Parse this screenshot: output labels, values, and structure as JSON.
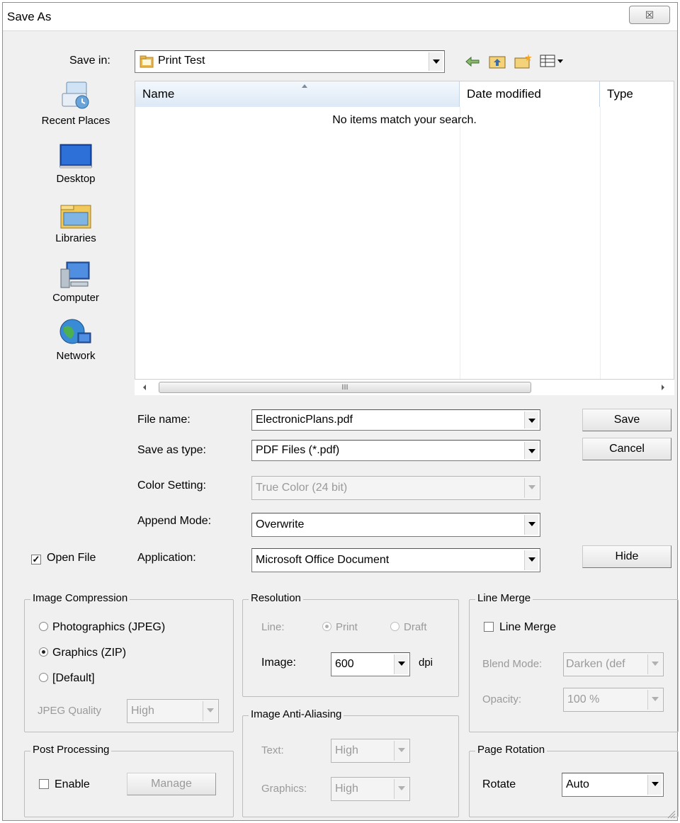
{
  "window": {
    "title": "Save As",
    "close_glyph": "☒"
  },
  "save_in": {
    "label": "Save in:",
    "value": "Print Test",
    "icons": [
      "back-arrow-icon",
      "up-folder-icon",
      "new-folder-icon",
      "view-menu-icon"
    ]
  },
  "places": [
    {
      "label": "Recent Places",
      "icon": "recent-places-icon"
    },
    {
      "label": "Desktop",
      "icon": "desktop-icon"
    },
    {
      "label": "Libraries",
      "icon": "libraries-icon"
    },
    {
      "label": "Computer",
      "icon": "computer-icon"
    },
    {
      "label": "Network",
      "icon": "network-icon"
    }
  ],
  "file_list": {
    "columns": [
      "Name",
      "Date modified",
      "Type"
    ],
    "empty_message": "No items match your search.",
    "scroll_grip": "III"
  },
  "form": {
    "file_name": {
      "label": "File name:",
      "value": "ElectronicPlans.pdf"
    },
    "save_as_type": {
      "label": "Save as type:",
      "value": "PDF Files (*.pdf)"
    },
    "color_setting": {
      "label": "Color Setting:",
      "value": "True Color (24 bit)"
    },
    "append_mode": {
      "label": "Append Mode:",
      "value": "Overwrite"
    },
    "application": {
      "label": "Application:",
      "value": "Microsoft Office Document"
    },
    "open_file": {
      "label": "Open File",
      "checked": true
    }
  },
  "buttons": {
    "save": "Save",
    "cancel": "Cancel",
    "hide": "Hide",
    "manage": "Manage"
  },
  "image_compression": {
    "title": "Image Compression",
    "options": [
      {
        "label": "Photographics (JPEG)",
        "selected": false
      },
      {
        "label": "Graphics (ZIP)",
        "selected": true
      },
      {
        "label": "[Default]",
        "selected": false
      }
    ],
    "jpeg_quality_label": "JPEG Quality",
    "jpeg_quality_value": "High"
  },
  "resolution": {
    "title": "Resolution",
    "line_label": "Line:",
    "line_print": "Print",
    "line_draft": "Draft",
    "image_label": "Image:",
    "image_value": "600",
    "unit": "dpi"
  },
  "line_merge": {
    "title": "Line Merge",
    "checkbox_label": "Line Merge",
    "blend_mode_label": "Blend Mode:",
    "blend_mode_value": "Darken (def",
    "opacity_label": "Opacity:",
    "opacity_value": "100 %"
  },
  "anti_aliasing": {
    "title": "Image Anti-Aliasing",
    "text_label": "Text:",
    "text_value": "High",
    "graphics_label": "Graphics:",
    "graphics_value": "High"
  },
  "post_processing": {
    "title": "Post Processing",
    "enable_label": "Enable"
  },
  "page_rotation": {
    "title": "Page Rotation",
    "rotate_label": "Rotate",
    "rotate_value": "Auto"
  },
  "colors": {
    "header_blue": "#dde9f6",
    "folder_yellow": "#e8b84a",
    "dialog_bg": "#f0f0f0"
  }
}
